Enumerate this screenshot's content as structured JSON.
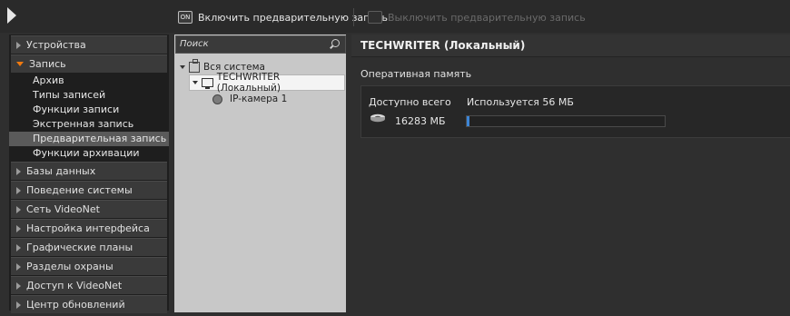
{
  "toolbar": {
    "enable_label": "Включить предварительную запись",
    "enable_icon": "ON",
    "disable_label": "Выключить предварительную запись"
  },
  "nav": {
    "items_top": [
      {
        "label": "Устройства"
      }
    ],
    "open_item": {
      "label": "Запись"
    },
    "sub_items": [
      {
        "label": "Архив"
      },
      {
        "label": "Типы записей"
      },
      {
        "label": "Функции записи"
      },
      {
        "label": "Экстренная запись"
      },
      {
        "label": "Предварительная запись"
      },
      {
        "label": "Функции архивации"
      }
    ],
    "selected_sub_index": 4,
    "items_bottom": [
      {
        "label": "Базы данных"
      },
      {
        "label": "Поведение системы"
      },
      {
        "label": "Сеть VideoNet"
      },
      {
        "label": "Настройка интерфейса"
      },
      {
        "label": "Графические планы"
      },
      {
        "label": "Разделы охраны"
      },
      {
        "label": "Доступ к VideoNet"
      },
      {
        "label": "Центр обновлений"
      }
    ]
  },
  "tree": {
    "search_placeholder": "Поиск",
    "root": "Вся система",
    "server": "TECHWRITER (Локальный)",
    "camera": "IP-камера 1"
  },
  "content": {
    "title": "TECHWRITER (Локальный)",
    "section": "Оперативная память",
    "available_label": "Доступно всего",
    "used_label": "Используется 56 МБ",
    "available_value": "16283 МБ",
    "used_fraction": 0.0034
  },
  "colors": {
    "accent_orange": "#f07a10",
    "progress_blue": "#3c85d6"
  }
}
